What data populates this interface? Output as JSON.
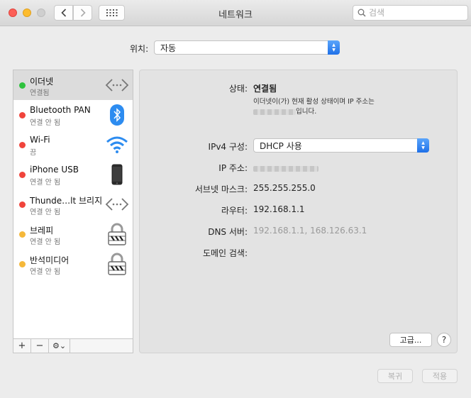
{
  "window": {
    "title": "네트워크"
  },
  "toolbar": {
    "search_placeholder": "검색"
  },
  "location": {
    "label": "위치:",
    "value": "자동"
  },
  "services": [
    {
      "name": "이더넷",
      "status": "연결됨",
      "status_color": "#2fc23e",
      "icon": "ethernet-icon"
    },
    {
      "name": "Bluetooth PAN",
      "status": "연결 안 됨",
      "status_color": "#f0443c",
      "icon": "bluetooth-icon"
    },
    {
      "name": "Wi-Fi",
      "status": "끔",
      "status_color": "#f0443c",
      "icon": "wifi-icon"
    },
    {
      "name": "iPhone USB",
      "status": "연결 안 됨",
      "status_color": "#f0443c",
      "icon": "iphone-icon"
    },
    {
      "name": "Thunde…lt 브리지",
      "status": "연결 안 됨",
      "status_color": "#f0443c",
      "icon": "ethernet-icon"
    },
    {
      "name": "브레피",
      "status": "연결 안 됨",
      "status_color": "#f5b83a",
      "icon": "lock-icon"
    },
    {
      "name": "반석미디어",
      "status": "연결 안 됨",
      "status_color": "#f5b83a",
      "icon": "lock-icon"
    }
  ],
  "sidebar_tools": {
    "add": "+",
    "remove": "−",
    "gear": "⚙︎⌄"
  },
  "detail": {
    "status_label": "상태:",
    "status_value": "연결됨",
    "description_line1": "이더넷이(가) 현재 활성 상태이며 IP 주소는",
    "description_line2_suffix": "입니다.",
    "ipv4_label": "IPv4 구성:",
    "ipv4_value": "DHCP 사용",
    "ip_label": "IP 주소:",
    "subnet_label": "서브넷 마스크:",
    "subnet_value": "255.255.255.0",
    "router_label": "라우터:",
    "router_value": "192.168.1.1",
    "dns_label": "DNS 서버:",
    "dns_value": "192.168.1.1, 168.126.63.1",
    "search_domain_label": "도메인 검색:",
    "advanced_button": "고급...",
    "help_button": "?"
  },
  "footer": {
    "revert": "복귀",
    "apply": "적용"
  }
}
